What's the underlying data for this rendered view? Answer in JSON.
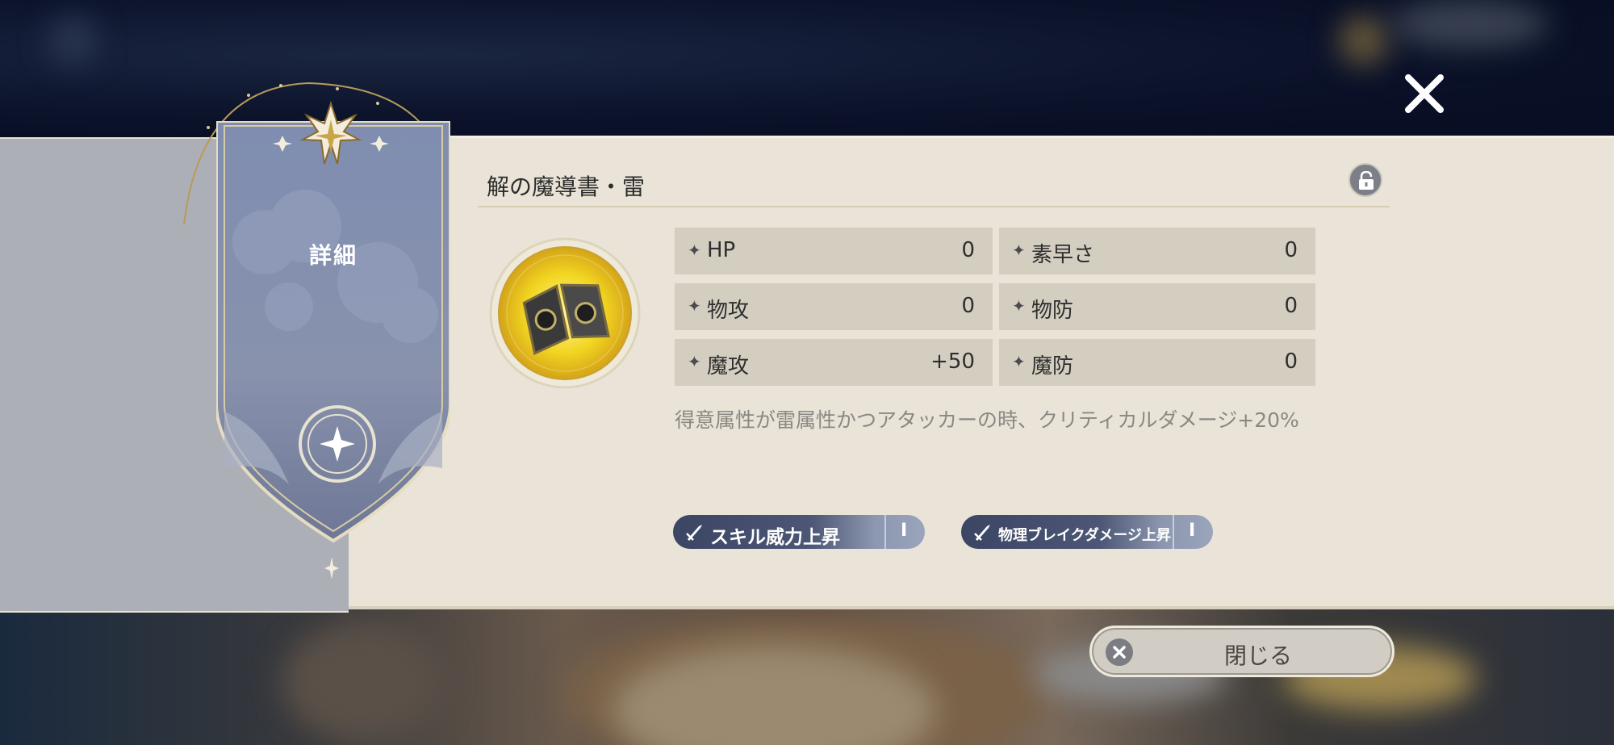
{
  "window": {
    "tab_label": "詳細"
  },
  "item": {
    "name": "解の魔導書・雷",
    "icon": "golden-grimoire-icon",
    "description": "得意属性が雷属性かつアタッカーの時、クリティカルダメージ+20%"
  },
  "stats": [
    {
      "label": "HP",
      "value": "0"
    },
    {
      "label": "素早さ",
      "value": "0"
    },
    {
      "label": "物攻",
      "value": "0"
    },
    {
      "label": "物防",
      "value": "0"
    },
    {
      "label": "魔攻",
      "value": "+50"
    },
    {
      "label": "魔防",
      "value": "0"
    }
  ],
  "tags": [
    {
      "label": "スキル威力上昇",
      "level": "I"
    },
    {
      "label": "物理ブレイクダメージ上昇",
      "level": "I"
    }
  ],
  "buttons": {
    "close_label": "閉じる"
  },
  "colors": {
    "panel": "#e9e4d7",
    "banner": "#7c88a8",
    "tag": "#3b4564",
    "accent_gold": "#c8a54a"
  }
}
